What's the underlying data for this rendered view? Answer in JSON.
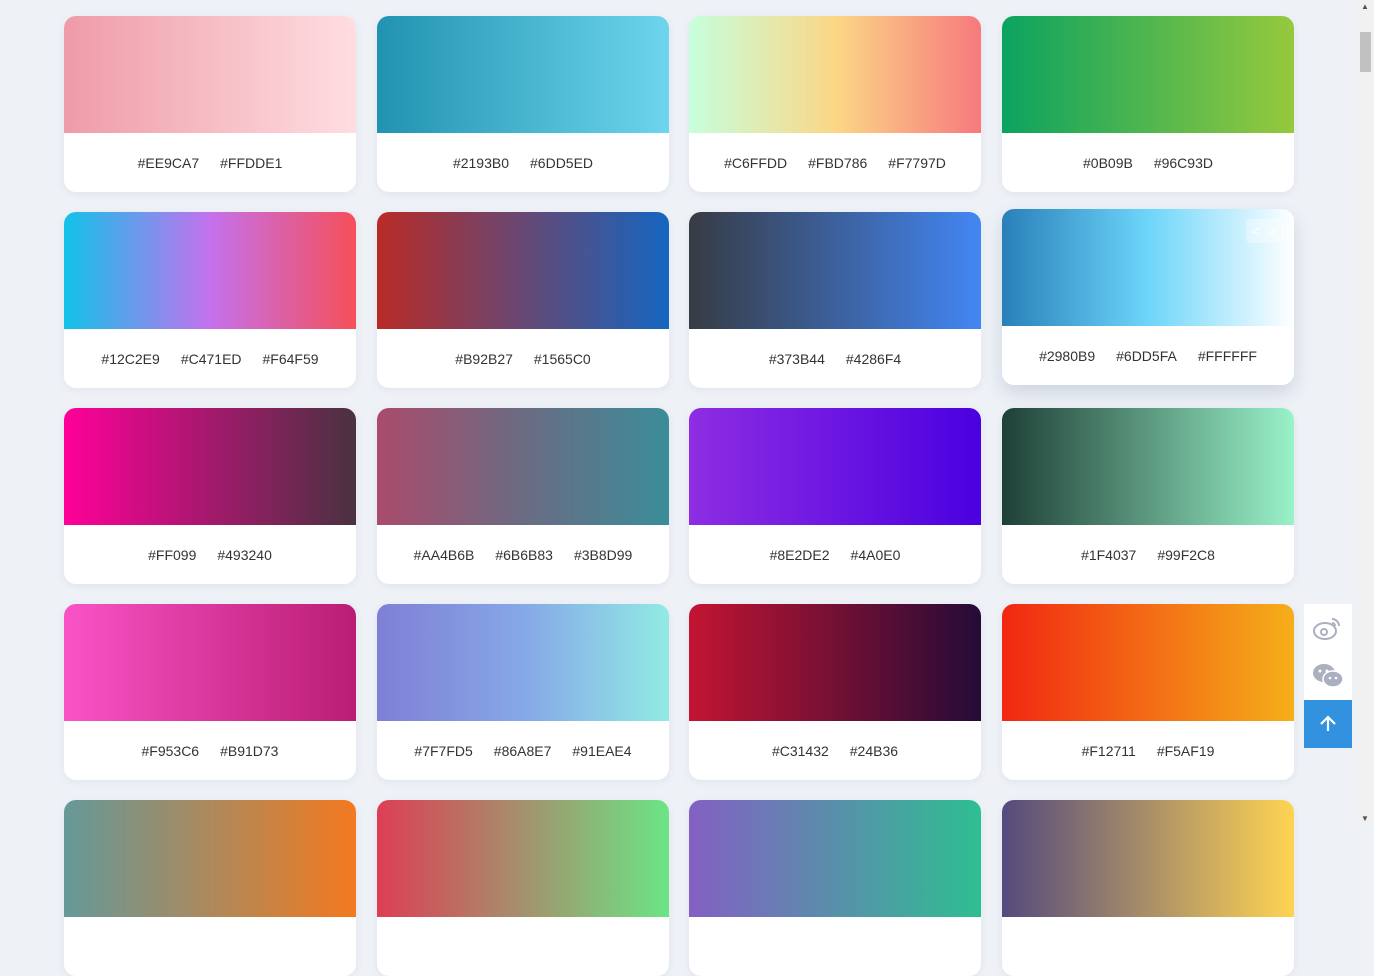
{
  "cards": [
    {
      "colors": [
        "#EE9CA7",
        "#FFDDE1"
      ]
    },
    {
      "colors": [
        "#2193B0",
        "#6DD5ED"
      ]
    },
    {
      "colors": [
        "#C6FFDD",
        "#FBD786",
        "#F7797D"
      ]
    },
    {
      "colors": [
        "#0B09B",
        "#96C93D"
      ],
      "render": [
        "#0BA360",
        "#96C93D"
      ]
    },
    {
      "colors": [
        "#12C2E9",
        "#C471ED",
        "#F64F59"
      ]
    },
    {
      "colors": [
        "#B92B27",
        "#1565C0"
      ]
    },
    {
      "colors": [
        "#373B44",
        "#4286F4"
      ]
    },
    {
      "colors": [
        "#2980B9",
        "#6DD5FA",
        "#FFFFFF"
      ],
      "raised": true,
      "toggle": "< >"
    },
    {
      "colors": [
        "#FF099",
        "#493240"
      ],
      "render": [
        "#FF0099",
        "#493240"
      ]
    },
    {
      "colors": [
        "#AA4B6B",
        "#6B6B83",
        "#3B8D99"
      ]
    },
    {
      "colors": [
        "#8E2DE2",
        "#4A0E0"
      ],
      "render": [
        "#8E2DE2",
        "#4A00E0"
      ]
    },
    {
      "colors": [
        "#1F4037",
        "#99F2C8"
      ]
    },
    {
      "colors": [
        "#F953C6",
        "#B91D73"
      ]
    },
    {
      "colors": [
        "#7F7FD5",
        "#86A8E7",
        "#91EAE4"
      ]
    },
    {
      "colors": [
        "#C31432",
        "#24B36"
      ],
      "render": [
        "#C31432",
        "#240B36"
      ]
    },
    {
      "colors": [
        "#F12711",
        "#F5AF19"
      ]
    },
    {
      "colors": [],
      "render": [
        "#659999",
        "#F4791F"
      ]
    },
    {
      "colors": [],
      "render": [
        "#DD3E54",
        "#6BE585"
      ]
    },
    {
      "colors": [],
      "render": [
        "#8360C3",
        "#2EBF91"
      ]
    },
    {
      "colors": [],
      "render": [
        "#544A7D",
        "#FFD452"
      ]
    }
  ],
  "side": {
    "weibo_icon": "weibo-icon",
    "wechat_icon": "wechat-icon",
    "top_icon": "arrow-up-icon",
    "accent": "#3292E0"
  }
}
